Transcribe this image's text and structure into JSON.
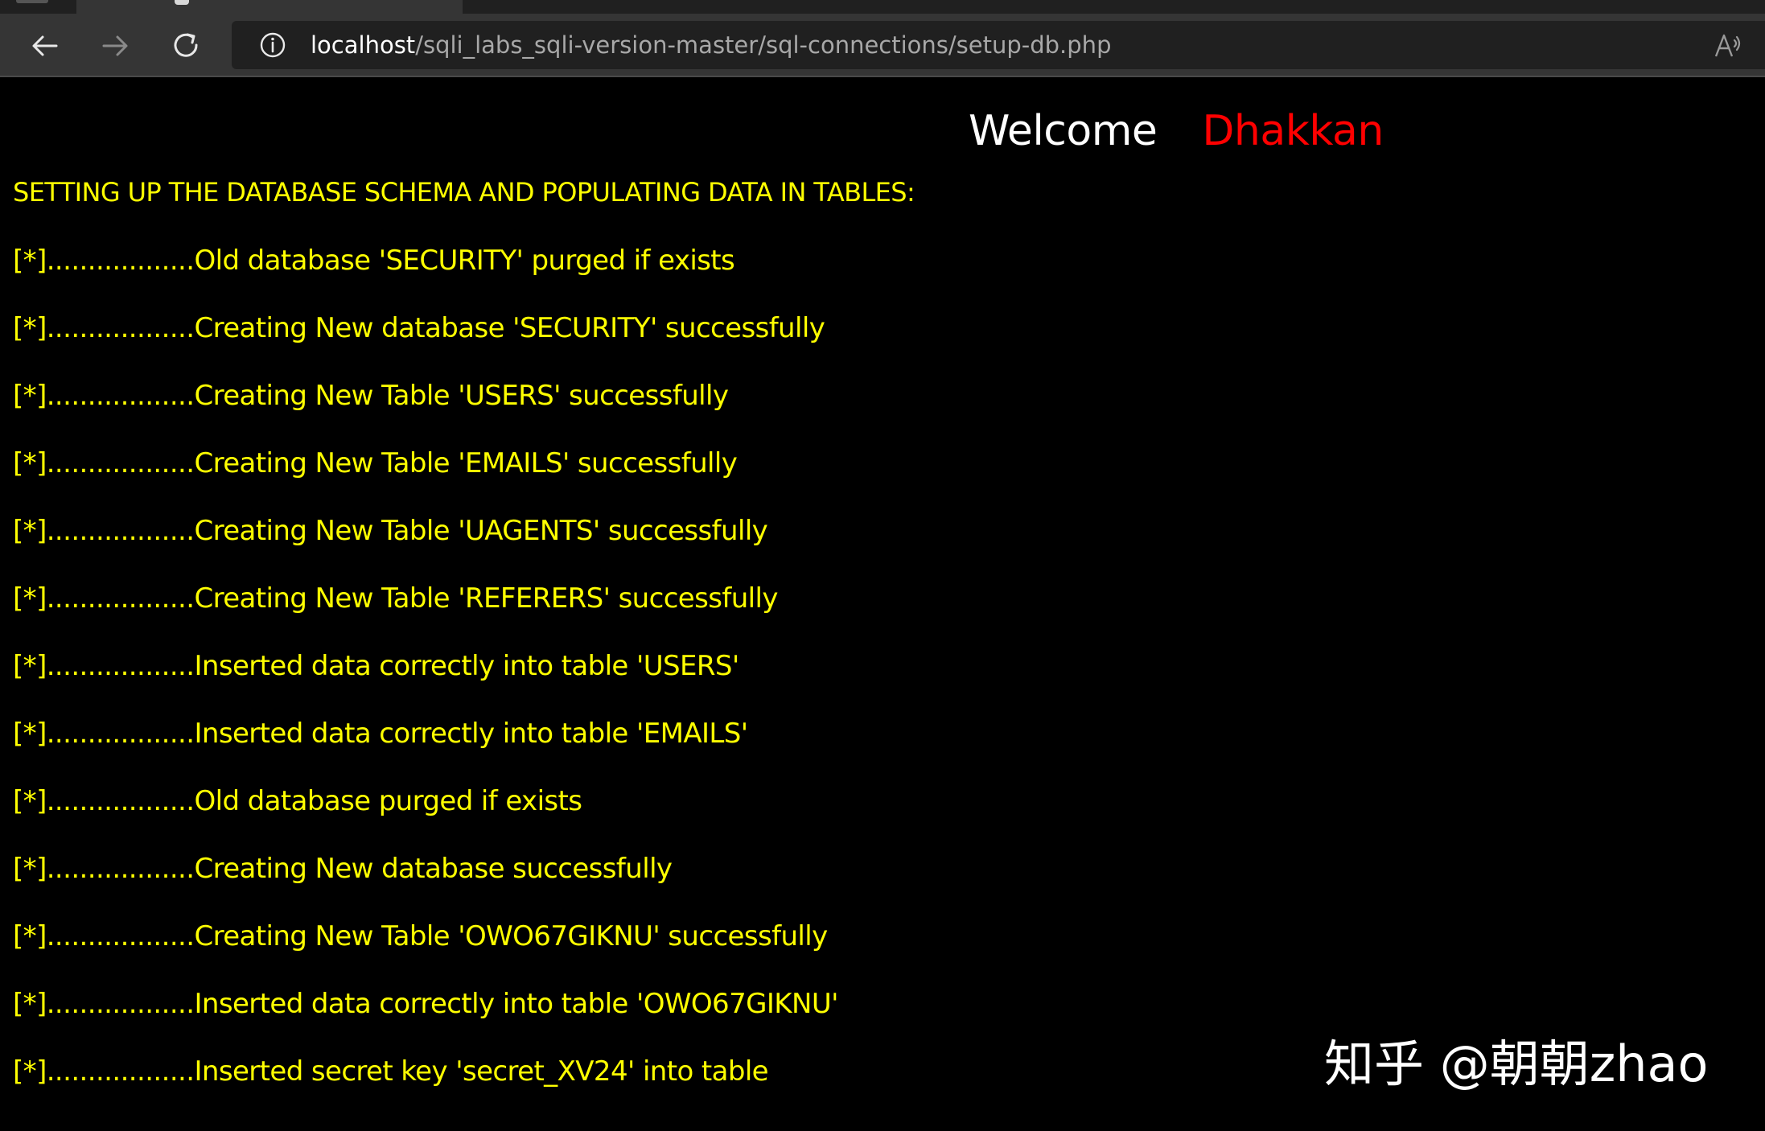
{
  "browser": {
    "url_host": "localhost",
    "url_path": "/sqli_labs_sqli-version-master/sql-connections/setup-db.php",
    "icons": {
      "back": "back-arrow-icon",
      "forward": "forward-arrow-icon",
      "refresh": "refresh-icon",
      "site_info": "info-icon",
      "read_aloud": "read-aloud-icon"
    }
  },
  "page": {
    "welcome_word": "Welcome",
    "welcome_name": "Dhakkan",
    "heading": "SETTING UP THE DATABASE SCHEMA AND POPULATING DATA IN TABLES:",
    "log_lines": [
      "[*]..................Old database 'SECURITY' purged if exists",
      "[*]..................Creating New database 'SECURITY' successfully",
      "[*]..................Creating New Table 'USERS' successfully",
      "[*]..................Creating New Table 'EMAILS' successfully",
      "[*]..................Creating New Table 'UAGENTS' successfully",
      "[*]..................Creating New Table 'REFERERS' successfully",
      "[*]..................Inserted data correctly into table 'USERS'",
      "[*]..................Inserted data correctly into table 'EMAILS'",
      "[*]..................Old database purged if exists",
      "[*]..................Creating New database successfully",
      "[*]..................Creating New Table 'OWO67GIKNU' successfully",
      "[*]..................Inserted data correctly into table 'OWO67GIKNU'",
      "[*]..................Inserted secret key 'secret_XV24' into table"
    ],
    "colors": {
      "background": "#000000",
      "log_text": "#ffff00",
      "welcome_word": "#ffffff",
      "welcome_name": "#ff0000"
    }
  },
  "watermark": {
    "text": "知乎 @朝朝zhao"
  }
}
